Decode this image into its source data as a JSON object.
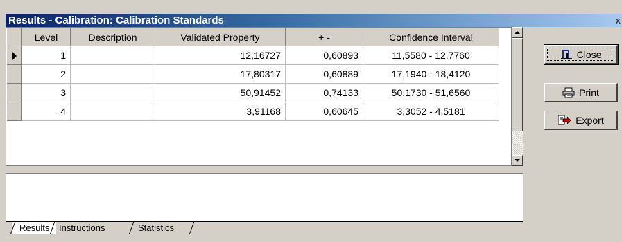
{
  "window": {
    "title": "Results - Calibration: Calibration Standards"
  },
  "grid": {
    "columns": [
      "Level",
      "Description",
      "Validated Property",
      "+ -",
      "Confidence Interval"
    ],
    "rows": [
      {
        "level": "1",
        "description": "",
        "validated_property": "12,16727",
        "pm": "0,60893",
        "confidence_interval": "11,5580 - 12,7760",
        "current": true
      },
      {
        "level": "2",
        "description": "",
        "validated_property": "17,80317",
        "pm": "0,60889",
        "confidence_interval": "17,1940 - 18,4120",
        "current": false
      },
      {
        "level": "3",
        "description": "",
        "validated_property": "50,91452",
        "pm": "0,74133",
        "confidence_interval": "50,1730 - 51,6560",
        "current": false
      },
      {
        "level": "4",
        "description": "",
        "validated_property": "3,91168",
        "pm": "0,60645",
        "confidence_interval": "3,3052 - 4,5181",
        "current": false
      }
    ]
  },
  "buttons": {
    "close": "Close",
    "print": "Print",
    "export": "Export"
  },
  "tabs": [
    "Results",
    "Instructions",
    "Statistics"
  ],
  "icons": {
    "row_indicator": "arrow-right-icon",
    "close": "door-exit-icon",
    "print": "printer-icon",
    "export": "export-arrow-icon"
  },
  "colors": {
    "title_gradient_start": "#0a246a",
    "title_gradient_end": "#a6caf0",
    "face": "#d4d0c8"
  }
}
